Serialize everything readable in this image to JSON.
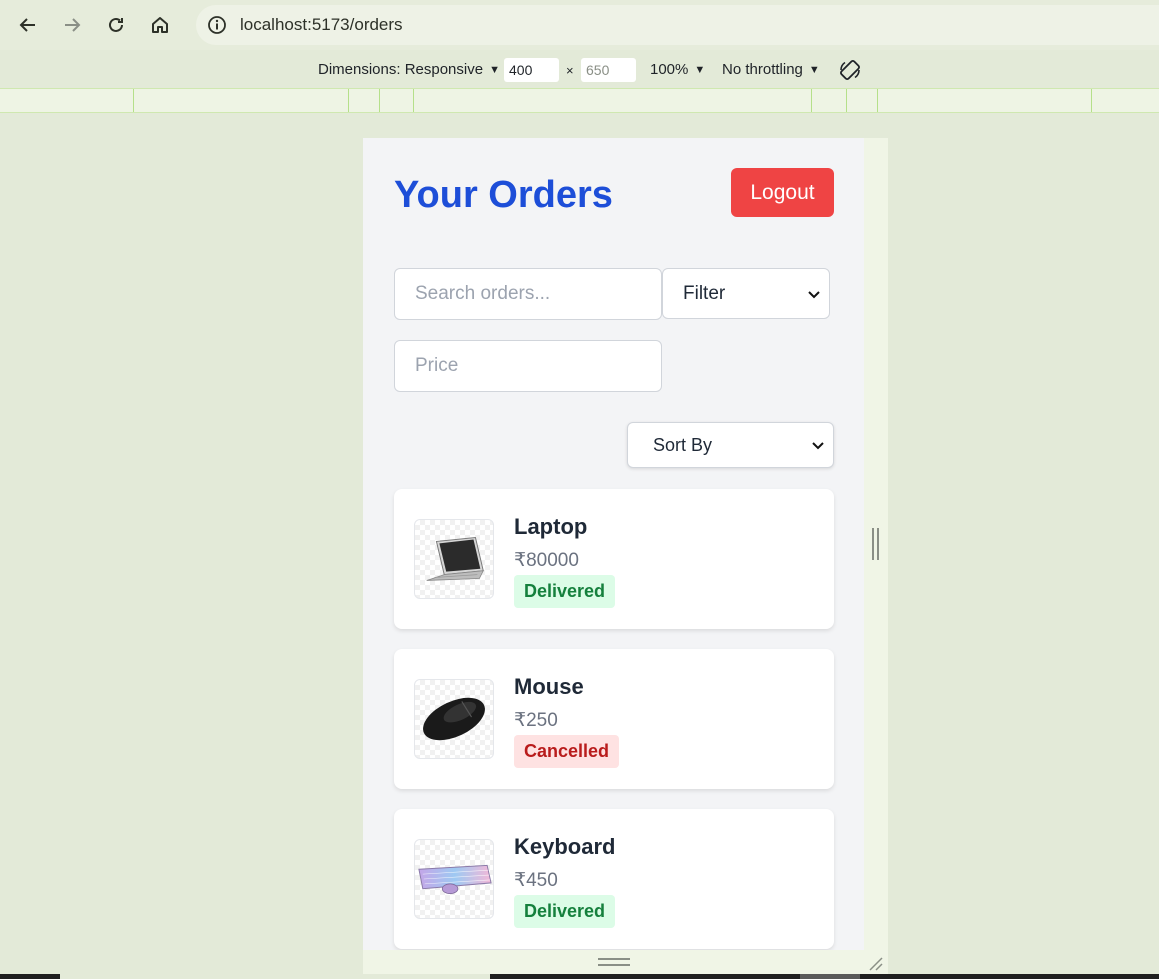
{
  "browser": {
    "url": "localhost:5173/orders"
  },
  "devtools": {
    "dimensions_label": "Dimensions: Responsive",
    "width_value": "400",
    "height_value": "650",
    "times_symbol": "×",
    "zoom_label": "100%",
    "throttling_label": "No throttling"
  },
  "page": {
    "title": "Your Orders",
    "logout_label": "Logout",
    "search_placeholder": "Search orders...",
    "filter_label": "Filter",
    "price_placeholder": "Price",
    "sort_label": "Sort By"
  },
  "orders": [
    {
      "name": "Laptop",
      "price": "₹80000",
      "status": "Delivered",
      "image_icon": "laptop-icon"
    },
    {
      "name": "Mouse",
      "price": "₹250",
      "status": "Cancelled",
      "image_icon": "mouse-icon"
    },
    {
      "name": "Keyboard",
      "price": "₹450",
      "status": "Delivered",
      "image_icon": "keyboard-icon"
    }
  ],
  "colors": {
    "title": "#1d4ed8",
    "logout": "#ef4444",
    "delivered_bg": "#dcfce7",
    "delivered_text": "#15803d",
    "cancelled_bg": "#fee2e2",
    "cancelled_text": "#b91c1c"
  }
}
